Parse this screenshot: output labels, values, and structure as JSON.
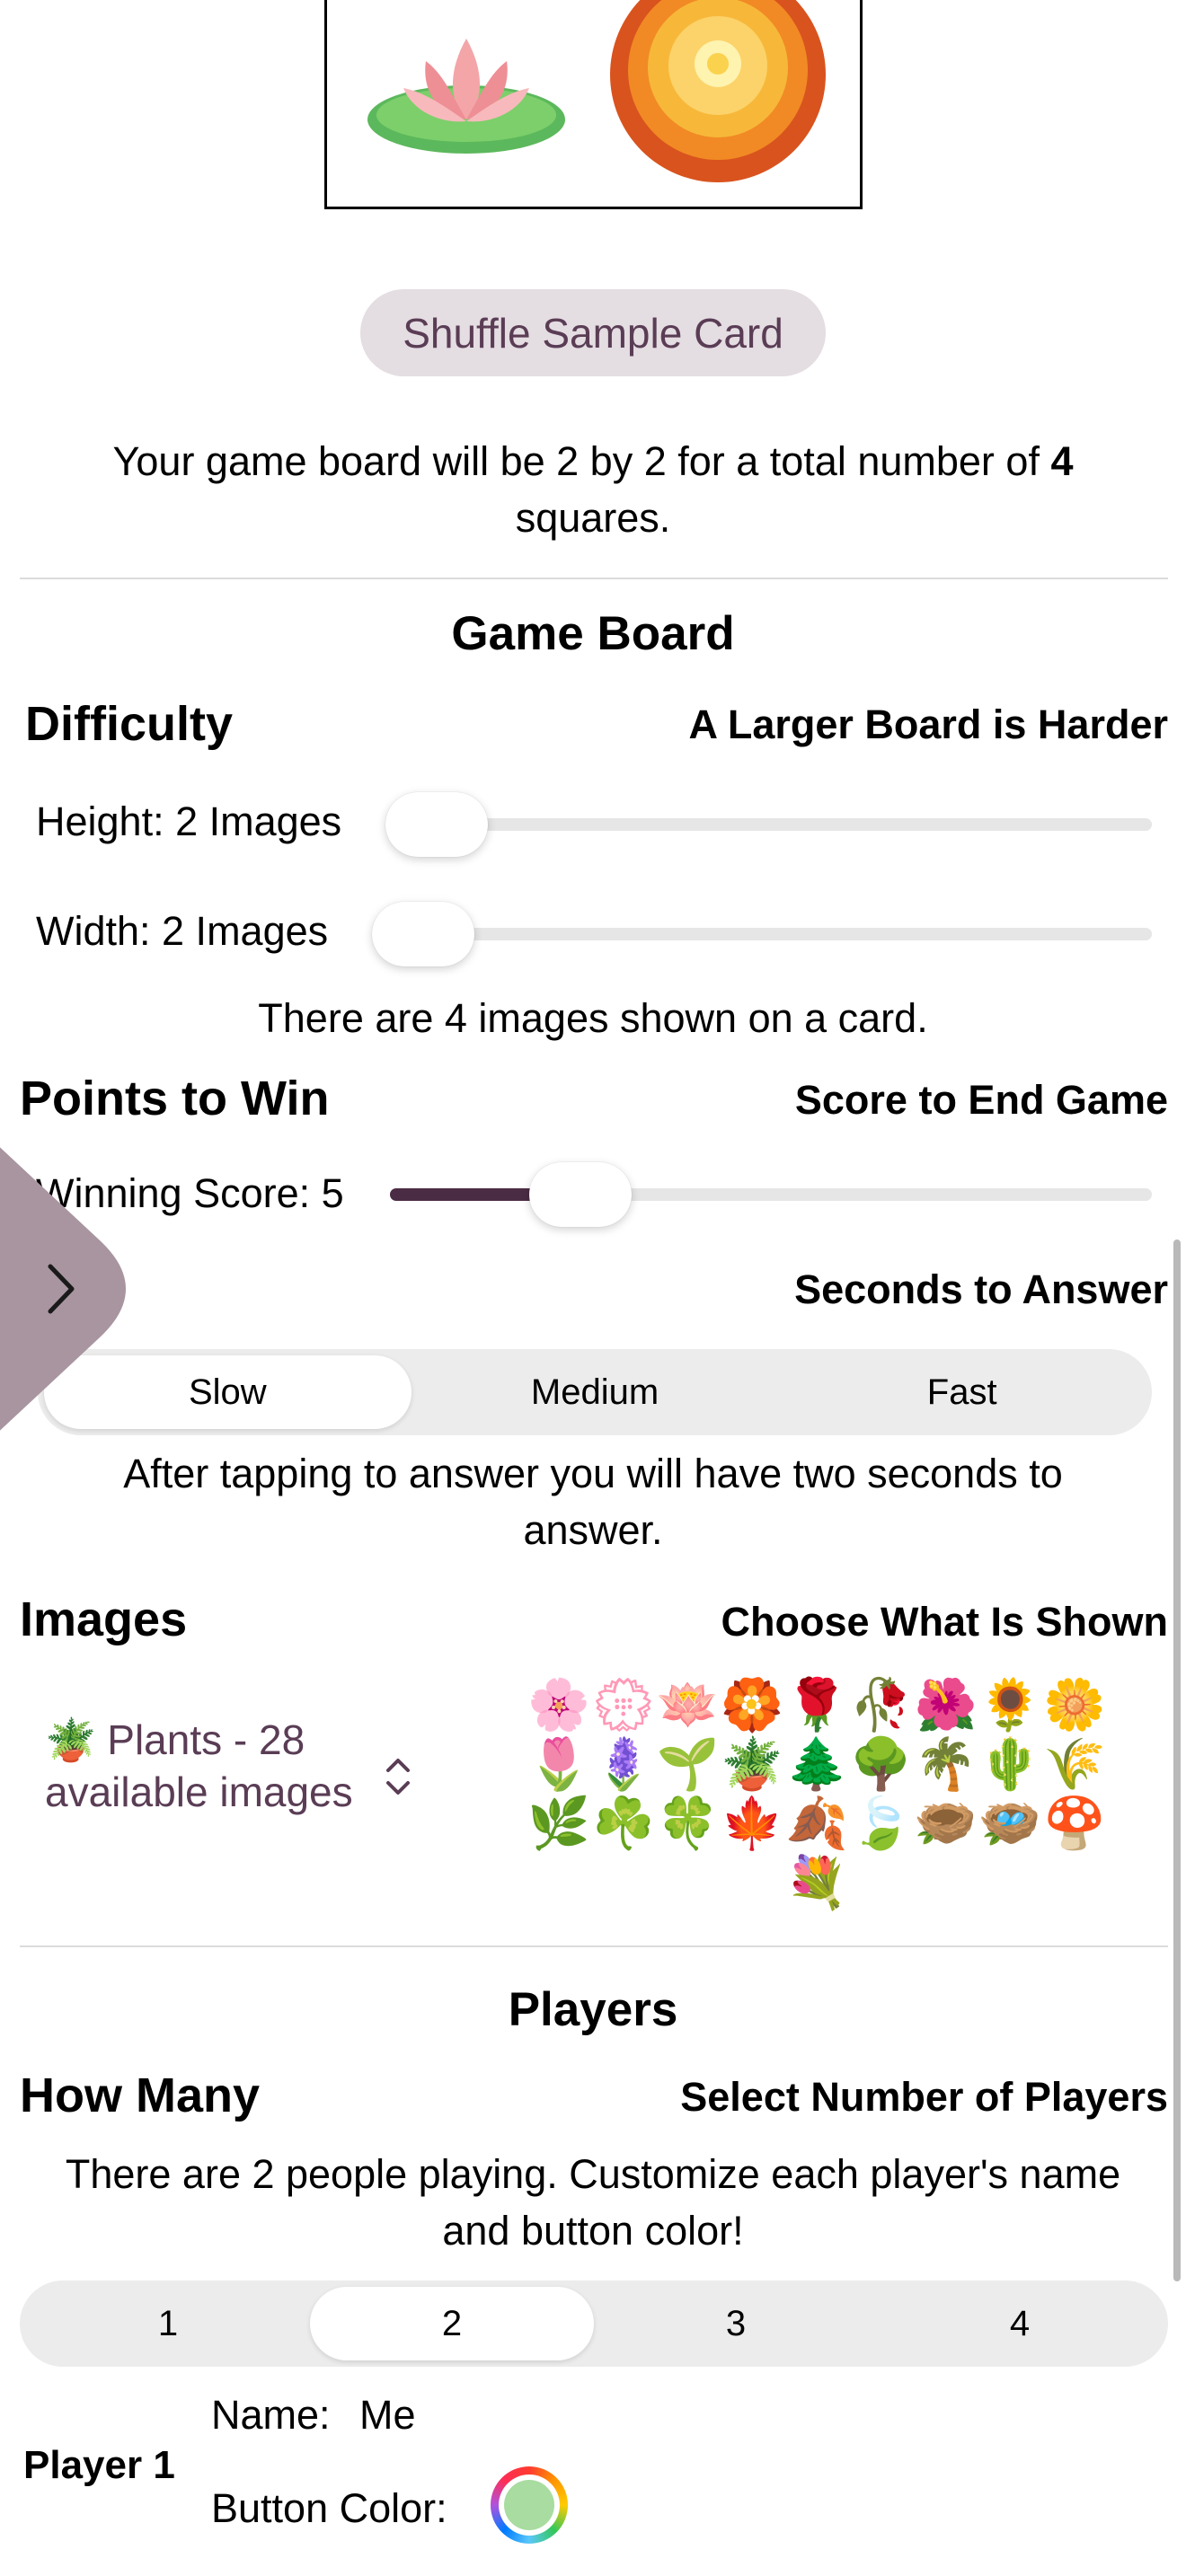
{
  "shuffle_button_label": "Shuffle Sample Card",
  "board_summary_prefix": "Your game board will be 2 by 2 for a total number of",
  "board_summary_count": "4",
  "board_summary_suffix": "squares.",
  "game_board": {
    "title": "Game Board",
    "difficulty_heading": "Difficulty",
    "difficulty_hint": "A Larger Board is Harder",
    "height_label": "Height: 2 Images",
    "height_value": 2,
    "width_label": "Width: 2 Images",
    "width_value": 2,
    "images_on_card": "There are 4 images shown on a card."
  },
  "points": {
    "heading": "Points to Win",
    "hint": "Score to End Game",
    "winning_label": "Winning Score: 5",
    "winning_value": 5
  },
  "speed": {
    "hint": "Seconds to Answer",
    "options": [
      "Slow",
      "Medium",
      "Fast"
    ],
    "selected": "Slow",
    "description": "After tapping to answer you will have two seconds to answer."
  },
  "images": {
    "heading": "Images",
    "hint": "Choose What Is Shown",
    "picker_icon": "🪴",
    "picker_label": "Plants - 28 available images",
    "emoji_set": "🌸💮🪷🏵️🌹🥀🌺🌻🌼🌷🪻🌱🪴🌲🌳🌴🌵🌾🌿☘️🍀🍁🍂🍃🪹🪺🍄💐"
  },
  "players": {
    "title": "Players",
    "heading": "How Many",
    "hint": "Select Number of Players",
    "description": "There are 2 people playing. Customize each player's name and button color!",
    "count_options": [
      "1",
      "2",
      "3",
      "4"
    ],
    "selected_count": "2",
    "player1": {
      "label": "Player 1",
      "name_label": "Name:",
      "name_value": "Me",
      "color_label": "Button Color:",
      "color": "#a8dca0"
    }
  },
  "colors": {
    "accent": "#4b2c45",
    "button_bg": "#e4dde2",
    "side_tab": "#a8959f"
  }
}
